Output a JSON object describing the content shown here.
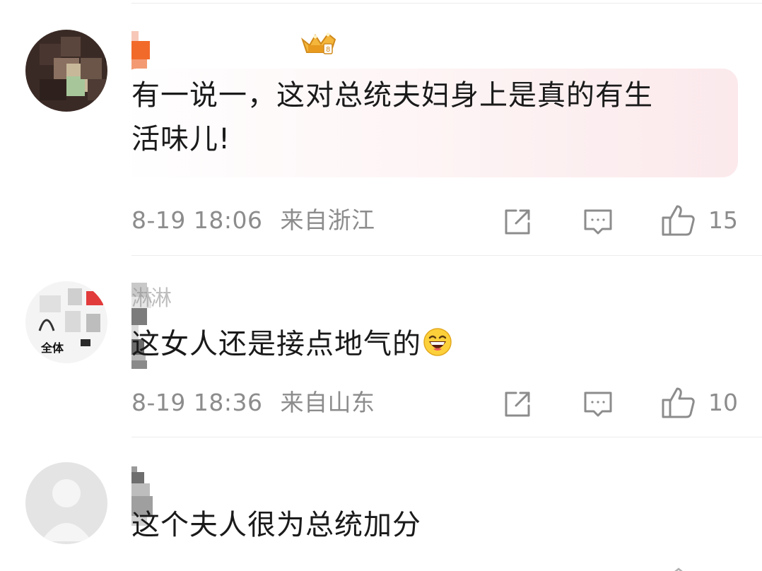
{
  "comments": [
    {
      "text_lines": [
        "有一说一，这对总统夫妇身上是真的有生",
        "活味儿!"
      ],
      "time": "8-19 18:06",
      "location": "来自浙江",
      "likes": "15",
      "has_badge": true,
      "highlighted": true
    },
    {
      "name_fragment": "淋淋",
      "avatar_text": "全体",
      "text": "这女人还是接点地气的",
      "emoji": "grinning-face-emoji",
      "time": "8-19 18:36",
      "location": "来自山东",
      "likes": "10"
    },
    {
      "text": "这个夫人很为总统加分"
    }
  ],
  "icons": {
    "share": "share-icon",
    "comment": "comment-icon",
    "like": "thumbs-up-icon",
    "badge": "crown-badge-icon"
  },
  "colors": {
    "meta_text": "#8c8c8c",
    "comment_text": "#1a1a1a",
    "bubble_highlight": "#fbe9ec"
  }
}
